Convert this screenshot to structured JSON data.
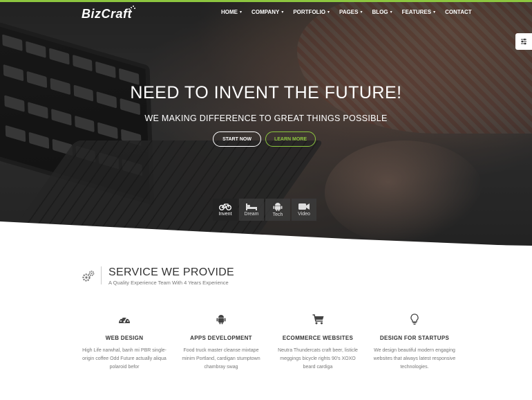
{
  "brand": {
    "logo_text": "BizCraft"
  },
  "nav": {
    "items": [
      {
        "label": "HOME",
        "has_dropdown": true
      },
      {
        "label": "COMPANY",
        "has_dropdown": true
      },
      {
        "label": "PORTFOLIO",
        "has_dropdown": true
      },
      {
        "label": "PAGES",
        "has_dropdown": true
      },
      {
        "label": "BLOG",
        "has_dropdown": true
      },
      {
        "label": "FEATURES",
        "has_dropdown": true
      },
      {
        "label": "CONTACT",
        "has_dropdown": false
      }
    ]
  },
  "hero": {
    "title": "NEED TO INVENT THE FUTURE!",
    "subtitle": "WE MAKING DIFFERENCE TO GREAT THINGS POSSIBLE",
    "buttons": {
      "start": "START NOW",
      "learn": "LEARN MORE"
    },
    "tabs": [
      {
        "label": "Invent",
        "icon": "bicycle-icon",
        "active": true
      },
      {
        "label": "Dream",
        "icon": "bed-icon",
        "active": false
      },
      {
        "label": "Tech",
        "icon": "android-icon",
        "active": false
      },
      {
        "label": "Video",
        "icon": "video-camera-icon",
        "active": false
      }
    ]
  },
  "services": {
    "title": "SERVICE WE PROVIDE",
    "subtitle": "A Quality Experience Team With 4 Years Experience",
    "items": [
      {
        "title": "WEB DESIGN",
        "icon": "dashboard-icon",
        "desc": "High Life narwhal, banh mi PBR single-origin coffee Odd Future actually aliqua polaroid befor"
      },
      {
        "title": "APPS DEVELOPMENT",
        "icon": "android-icon",
        "desc": "Food truck master cleanse mixtape minim Portland, cardigan stumptown chambray swag"
      },
      {
        "title": "ECOMMERCE WEBSITES",
        "icon": "shopping-cart-icon",
        "desc": "Neutra Thundercats craft beer, listicle meggings bicycle rights 90's XOXO beard cardiga"
      },
      {
        "title": "DESIGN FOR STARTUPS",
        "icon": "lightbulb-icon",
        "desc": "We design beautiful modern engaging websites that always latest responsive technologies."
      }
    ]
  },
  "colors": {
    "accent": "#8cc63f",
    "text_dark": "#333333",
    "text_muted": "#777777"
  }
}
